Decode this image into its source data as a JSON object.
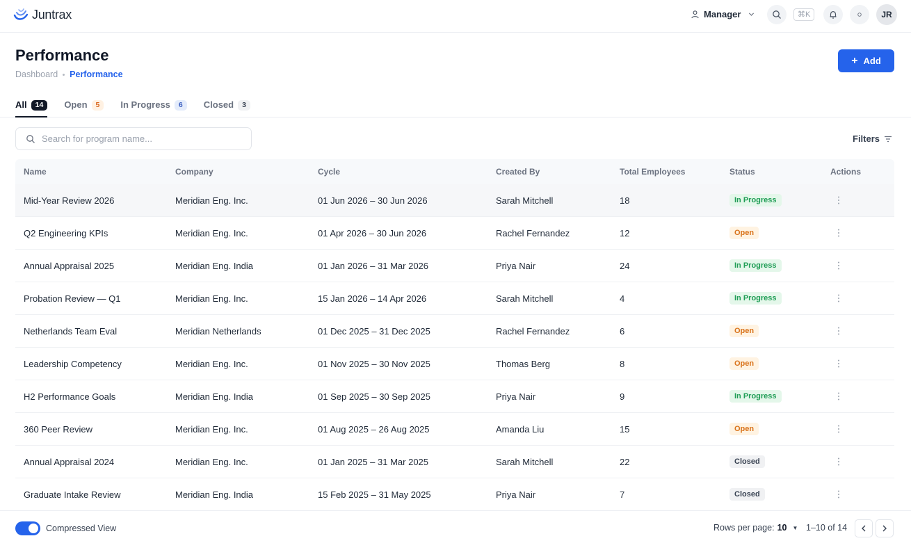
{
  "app": {
    "name": "Juntrax"
  },
  "header": {
    "role": "Manager",
    "shortcut": "⌘K",
    "avatar_initials": "JR"
  },
  "page": {
    "title": "Performance",
    "breadcrumb": [
      "Dashboard",
      "Performance"
    ],
    "add_label": "Add"
  },
  "tabs": [
    {
      "label": "All",
      "count": "14"
    },
    {
      "label": "Open",
      "count": "5"
    },
    {
      "label": "In Progress",
      "count": "6"
    },
    {
      "label": "Closed",
      "count": "3"
    }
  ],
  "search": {
    "placeholder": "Search for program name..."
  },
  "filters_label": "Filters",
  "table": {
    "columns": [
      "Name",
      "Company",
      "Cycle",
      "Created By",
      "Total Employees",
      "Status",
      "Actions"
    ],
    "rows": [
      {
        "name": "Mid-Year Review 2026",
        "company": "Meridian Eng. Inc.",
        "cycle": "01 Jun 2026 – 30 Jun 2026",
        "created_by": "Sarah Mitchell",
        "employees": "18",
        "status": "In Progress"
      },
      {
        "name": "Q2 Engineering KPIs",
        "company": "Meridian Eng. Inc.",
        "cycle": "01 Apr 2026 – 30 Jun 2026",
        "created_by": "Rachel Fernandez",
        "employees": "12",
        "status": "Open"
      },
      {
        "name": "Annual Appraisal 2025",
        "company": "Meridian Eng. India",
        "cycle": "01 Jan 2026 – 31 Mar 2026",
        "created_by": "Priya Nair",
        "employees": "24",
        "status": "In Progress"
      },
      {
        "name": "Probation Review — Q1",
        "company": "Meridian Eng. Inc.",
        "cycle": "15 Jan 2026 – 14 Apr 2026",
        "created_by": "Sarah Mitchell",
        "employees": "4",
        "status": "In Progress"
      },
      {
        "name": "Netherlands Team Eval",
        "company": "Meridian Netherlands",
        "cycle": "01 Dec 2025 – 31 Dec 2025",
        "created_by": "Rachel Fernandez",
        "employees": "6",
        "status": "Open"
      },
      {
        "name": "Leadership Competency",
        "company": "Meridian Eng. Inc.",
        "cycle": "01 Nov 2025 – 30 Nov 2025",
        "created_by": "Thomas Berg",
        "employees": "8",
        "status": "Open"
      },
      {
        "name": "H2 Performance Goals",
        "company": "Meridian Eng. India",
        "cycle": "01 Sep 2025 – 30 Sep 2025",
        "created_by": "Priya Nair",
        "employees": "9",
        "status": "In Progress"
      },
      {
        "name": "360 Peer Review",
        "company": "Meridian Eng. Inc.",
        "cycle": "01 Aug 2025 – 26 Aug 2025",
        "created_by": "Amanda Liu",
        "employees": "15",
        "status": "Open"
      },
      {
        "name": "Annual Appraisal 2024",
        "company": "Meridian Eng. Inc.",
        "cycle": "01 Jan 2025 – 31 Mar 2025",
        "created_by": "Sarah Mitchell",
        "employees": "22",
        "status": "Closed"
      },
      {
        "name": "Graduate Intake Review",
        "company": "Meridian Eng. India",
        "cycle": "15 Feb 2025 – 31 May 2025",
        "created_by": "Priya Nair",
        "employees": "7",
        "status": "Closed"
      }
    ]
  },
  "footer": {
    "toggle_label": "Compressed View",
    "rows_per_page_label": "Rows per page:",
    "rows_per_page": "10",
    "range": "1–10 of 14"
  },
  "colors": {
    "accent": "#2563eb",
    "in_progress": "#1f9d55",
    "open": "#d9731b",
    "closed": "#374151"
  }
}
